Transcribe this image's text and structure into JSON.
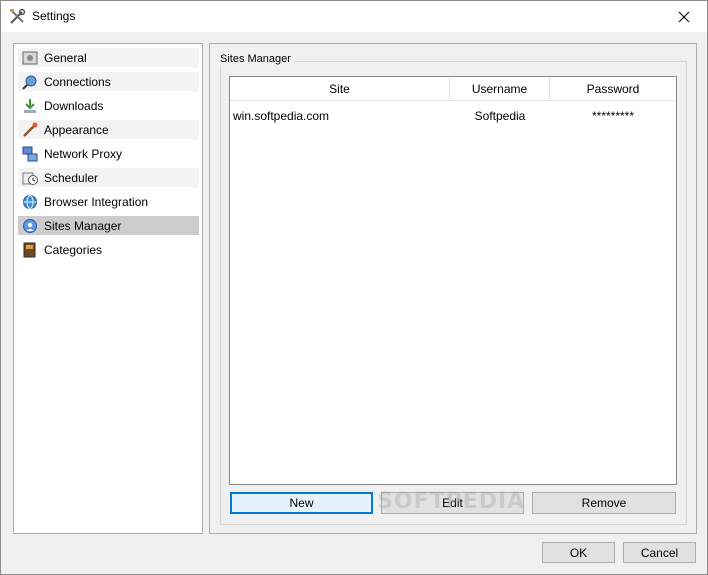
{
  "window": {
    "title": "Settings",
    "title_icon": "tools-icon",
    "close_icon": "close-icon"
  },
  "sidebar": {
    "items": [
      {
        "label": "General",
        "icon": "general-icon"
      },
      {
        "label": "Connections",
        "icon": "connections-icon"
      },
      {
        "label": "Downloads",
        "icon": "downloads-icon"
      },
      {
        "label": "Appearance",
        "icon": "appearance-icon"
      },
      {
        "label": "Network Proxy",
        "icon": "network-proxy-icon"
      },
      {
        "label": "Scheduler",
        "icon": "scheduler-icon"
      },
      {
        "label": "Browser Integration",
        "icon": "browser-integration-icon"
      },
      {
        "label": "Sites Manager",
        "icon": "sites-manager-icon"
      },
      {
        "label": "Categories",
        "icon": "categories-icon"
      }
    ],
    "selected": "Sites Manager"
  },
  "sites_manager": {
    "group_title": "Sites Manager",
    "columns": [
      "Site",
      "Username",
      "Password"
    ],
    "rows": [
      {
        "site": "win.softpedia.com",
        "username": "Softpedia",
        "password": "*********"
      }
    ],
    "buttons": {
      "new": "New",
      "edit": "Edit",
      "remove": "Remove"
    }
  },
  "footer": {
    "ok": "OK",
    "cancel": "Cancel"
  },
  "watermark": "SOFTPEDIA",
  "colors": {
    "selection": "#cccccc",
    "focus_border": "#0078d7",
    "window_bg": "#f0f0f0"
  }
}
